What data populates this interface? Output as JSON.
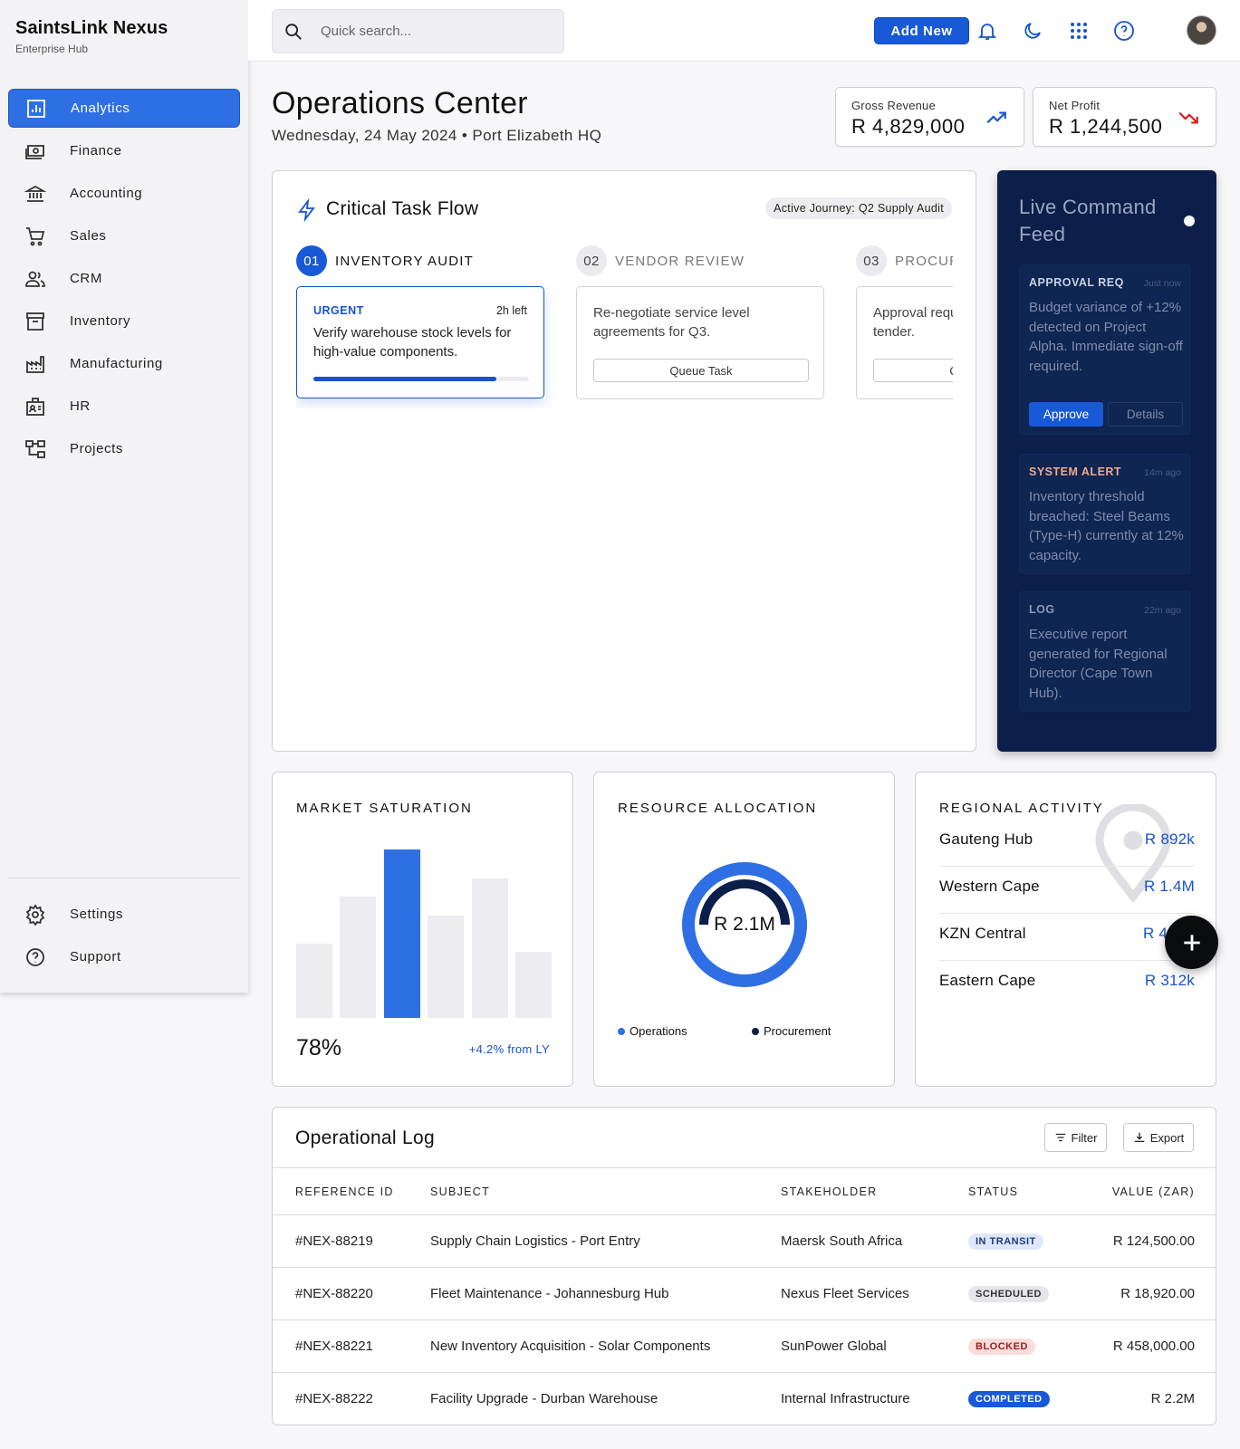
{
  "brand": {
    "title": "SaintsLink Nexus",
    "subtitle": "Enterprise Hub"
  },
  "sidebar": {
    "items": [
      {
        "label": "Analytics",
        "icon": "analytics-icon",
        "active": true
      },
      {
        "label": "Finance",
        "icon": "finance-icon"
      },
      {
        "label": "Accounting",
        "icon": "accounting-icon"
      },
      {
        "label": "Sales",
        "icon": "cart-icon"
      },
      {
        "label": "CRM",
        "icon": "users-icon"
      },
      {
        "label": "Inventory",
        "icon": "archive-icon"
      },
      {
        "label": "Manufacturing",
        "icon": "factory-icon"
      },
      {
        "label": "HR",
        "icon": "badge-icon"
      },
      {
        "label": "Projects",
        "icon": "hierarchy-icon"
      }
    ],
    "bottom": [
      {
        "label": "Settings",
        "icon": "gear-icon"
      },
      {
        "label": "Support",
        "icon": "help-icon"
      }
    ]
  },
  "header": {
    "search_placeholder": "Quick search...",
    "add_label": "Add New"
  },
  "page": {
    "title": "Operations Center",
    "subtitle": "Wednesday, 24 May 2024 • Port Elizabeth HQ"
  },
  "kpis": [
    {
      "label": "Gross Revenue",
      "value": "R 4,829,000",
      "trend": "up",
      "color": "#1654cc"
    },
    {
      "label": "Net Profit",
      "value": "R 1,244,500",
      "trend": "down",
      "color": "#d81c1c"
    }
  ],
  "flow": {
    "title": "Critical Task Flow",
    "journey": "Active Journey: Q2 Supply Audit",
    "steps": [
      {
        "num": "01",
        "name": "INVENTORY AUDIT",
        "tag": "URGENT",
        "time": "2h left",
        "text": "Verify warehouse stock levels for high-value components.",
        "progress": 0.85
      },
      {
        "num": "02",
        "name": "VENDOR REVIEW",
        "text": "Re-negotiate service level agreements for Q3.",
        "button": "Queue Task"
      },
      {
        "num": "03",
        "name": "PROCUREMENT",
        "text": "Approval request for new hardware tender.",
        "button": "Queue Task"
      }
    ]
  },
  "feed": {
    "title": "Live Command Feed",
    "items": [
      {
        "tag": "APPROVAL REQ",
        "time": "Just now",
        "text": "Budget variance of +12% detected on Project Alpha. Immediate sign-off required.",
        "approve": "Approve",
        "details": "Details",
        "tag_color": "#c8d0e2"
      },
      {
        "tag": "SYSTEM ALERT",
        "time": "14m ago",
        "text": "Inventory threshold breached: Steel Beams (Type-H) currently at 12% capacity.",
        "tag_color": "#f0a98a"
      },
      {
        "tag": "LOG",
        "time": "22m ago",
        "text": "Executive report generated for Regional Director (Cape Town Hub).",
        "tag_color": "#8d99b8"
      }
    ]
  },
  "market": {
    "title": "MARKET SATURATION",
    "value": "78%",
    "delta": "+4.2% from LY",
    "bars": [
      0.44,
      0.72,
      1.0,
      0.61,
      0.83,
      0.39
    ],
    "highlight_index": 2
  },
  "resource": {
    "title": "RESOURCE ALLOCATION",
    "center": "R 2.1M",
    "legend": [
      {
        "label": "Operations",
        "color": "#2f6fe4"
      },
      {
        "label": "Procurement",
        "color": "#0c1f4a"
      }
    ]
  },
  "regional": {
    "title": "REGIONAL ACTIVITY",
    "rows": [
      {
        "name": "Gauteng Hub",
        "value": "R 892k"
      },
      {
        "name": "Western Cape",
        "value": "R 1.4M"
      },
      {
        "name": "KZN Central",
        "value": "R 4"
      },
      {
        "name": "Eastern Cape",
        "value": "R 312k"
      }
    ]
  },
  "log": {
    "title": "Operational Log",
    "filter": "Filter",
    "export": "Export",
    "columns": [
      "REFERENCE ID",
      "SUBJECT",
      "STAKEHOLDER",
      "STATUS",
      "VALUE (ZAR)"
    ],
    "rows": [
      {
        "id": "#NEX-88219",
        "subject": "Supply Chain Logistics - Port Entry",
        "stakeholder": "Maersk South Africa",
        "status": "IN TRANSIT",
        "status_kind": "transit",
        "value": "R 124,500.00"
      },
      {
        "id": "#NEX-88220",
        "subject": "Fleet Maintenance - Johannesburg Hub",
        "stakeholder": "Nexus Fleet Services",
        "status": "SCHEDULED",
        "status_kind": "scheduled",
        "value": "R 18,920.00"
      },
      {
        "id": "#NEX-88221",
        "subject": "New Inventory Acquisition - Solar Components",
        "stakeholder": "SunPower Global",
        "status": "BLOCKED",
        "status_kind": "blocked",
        "value": "R 458,000.00"
      },
      {
        "id": "#NEX-88222",
        "subject": "Facility Upgrade - Durban Warehouse",
        "stakeholder": "Internal Infrastructure",
        "status": "COMPLETED",
        "status_kind": "completed",
        "value": "R 2.2M"
      }
    ]
  },
  "colors": {
    "accent": "#1759d6",
    "feed_bg": "#0c1f4a",
    "up": "#1654cc",
    "down": "#d81c1c"
  }
}
